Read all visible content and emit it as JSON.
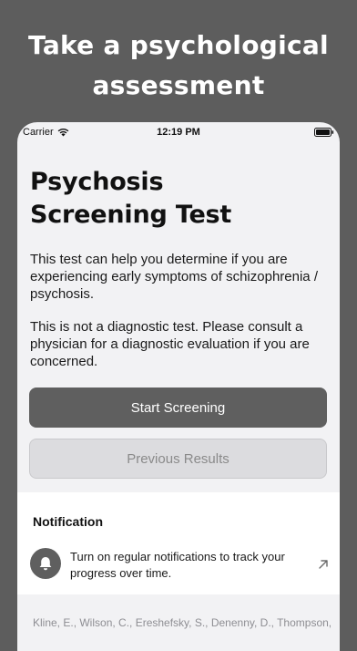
{
  "promo": {
    "headline_line1": "Take a psychological",
    "headline_line2": "assessment"
  },
  "status_bar": {
    "carrier": "Carrier",
    "time": "12:19 PM"
  },
  "screen": {
    "title": "Psychosis Screening Test",
    "description_1": "This test can help you determine if you are experiencing early symptoms of schizophrenia / psychosis.",
    "description_2": "This is not a diagnostic test. Please consult a physician for a diagnostic evaluation if you are concerned.",
    "start_button": "Start Screening",
    "previous_button": "Previous Results"
  },
  "notification": {
    "section_title": "Notification",
    "text": "Turn on regular notifications to track your progress over time."
  },
  "citation": {
    "line1": "Kline, E., Wilson, C., Ereshefsky, S., Denenny, D., Thompson,"
  }
}
